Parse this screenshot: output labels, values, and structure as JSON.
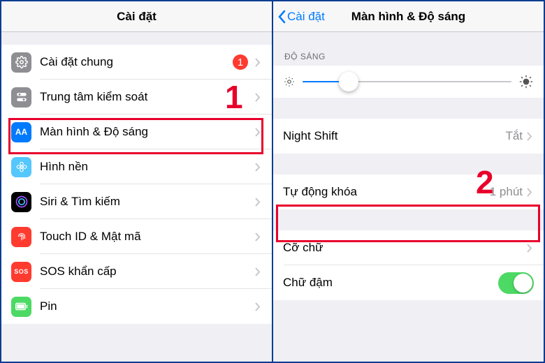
{
  "left": {
    "title": "Cài đặt",
    "badge_general": "1",
    "items": {
      "general": "Cài đặt chung",
      "control_center": "Trung tâm kiểm soát",
      "display": "Màn hình & Độ sáng",
      "wallpaper": "Hình nền",
      "siri": "Siri & Tìm kiếm",
      "touchid": "Touch ID & Mật mã",
      "sos": "SOS khẩn cấp",
      "battery": "Pin"
    },
    "sos_glyph": "SOS",
    "annotation": "1"
  },
  "right": {
    "back": "Cài đặt",
    "title": "Màn hình & Độ sáng",
    "brightness_header": "ĐỘ SÁNG",
    "brightness_percent": 22,
    "night_shift": {
      "label": "Night Shift",
      "value": "Tắt"
    },
    "auto_lock": {
      "label": "Tự động khóa",
      "value": "1 phút"
    },
    "text_size": "Cỡ chữ",
    "bold_text": "Chữ đậm",
    "bold_on": true,
    "annotation": "2"
  }
}
